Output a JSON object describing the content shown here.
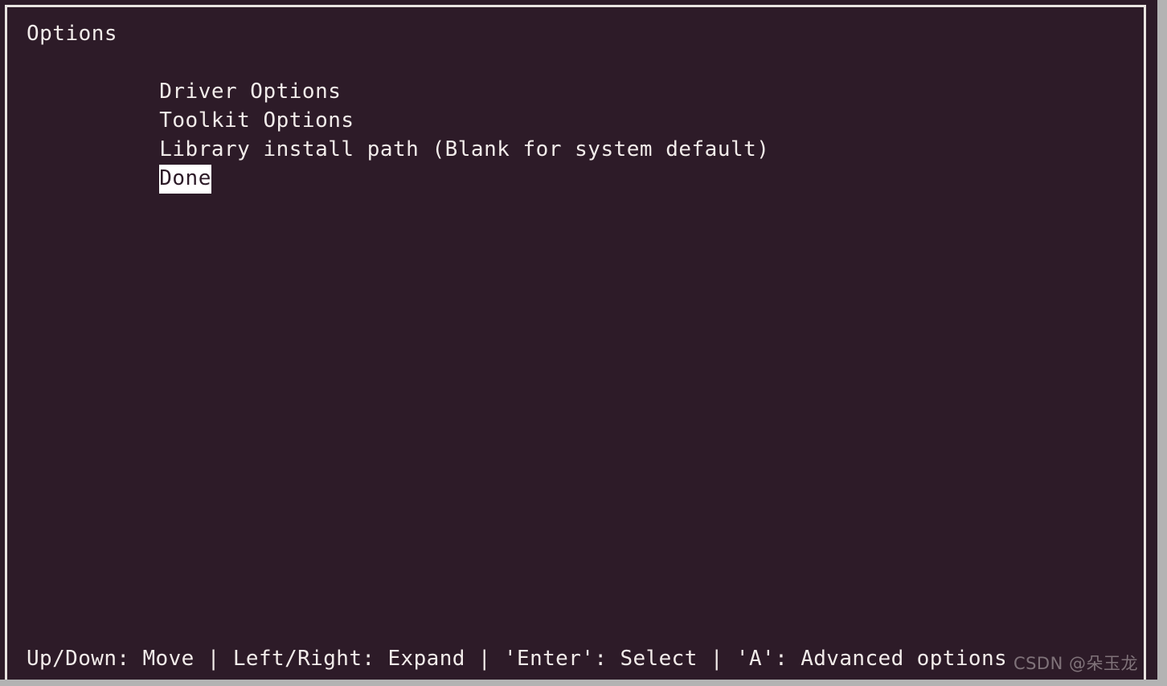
{
  "terminal": {
    "background_color": "#2d1b28",
    "foreground_color": "#f2ecea",
    "frame_color": "#e8e3e0",
    "outer_color": "#b3b3b3",
    "highlight_bg": "#ffffff",
    "highlight_fg": "#2d1b28"
  },
  "menu": {
    "title": "Options",
    "items": [
      {
        "label": "Driver Options",
        "selected": false,
        "depth": 1
      },
      {
        "label": "Toolkit Options",
        "selected": false,
        "depth": 1
      },
      {
        "label": "Library install path (Blank for system default)",
        "selected": false,
        "depth": 1
      },
      {
        "label": "Done",
        "selected": true,
        "depth": 1
      }
    ]
  },
  "statusbar": {
    "text": "Up/Down: Move | Left/Right: Expand | 'Enter': Select | 'A': Advanced options"
  },
  "watermark": {
    "text": "CSDN @朵玉龙"
  }
}
